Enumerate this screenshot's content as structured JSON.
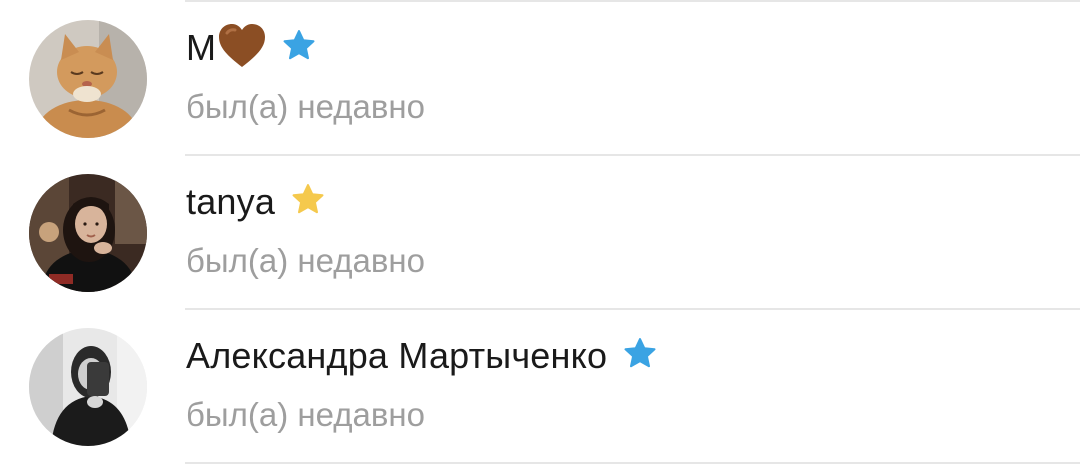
{
  "contacts": [
    {
      "name": "М",
      "heart": "brown-heart-icon",
      "star_color": "#3aa3e3",
      "status": "был(а) недавно"
    },
    {
      "name": "tanya",
      "star_color": "#f5c94d",
      "status": "был(а) недавно"
    },
    {
      "name": "Александра Мартыченко",
      "star_color": "#3aa3e3",
      "status": "был(а) недавно"
    }
  ],
  "colors": {
    "name_text": "#1a1a1a",
    "status_text": "#9e9e9e",
    "divider": "#e6e6e6",
    "heart": "#8b4e24",
    "star_blue": "#3aa3e3",
    "star_yellow": "#f5c94d"
  }
}
